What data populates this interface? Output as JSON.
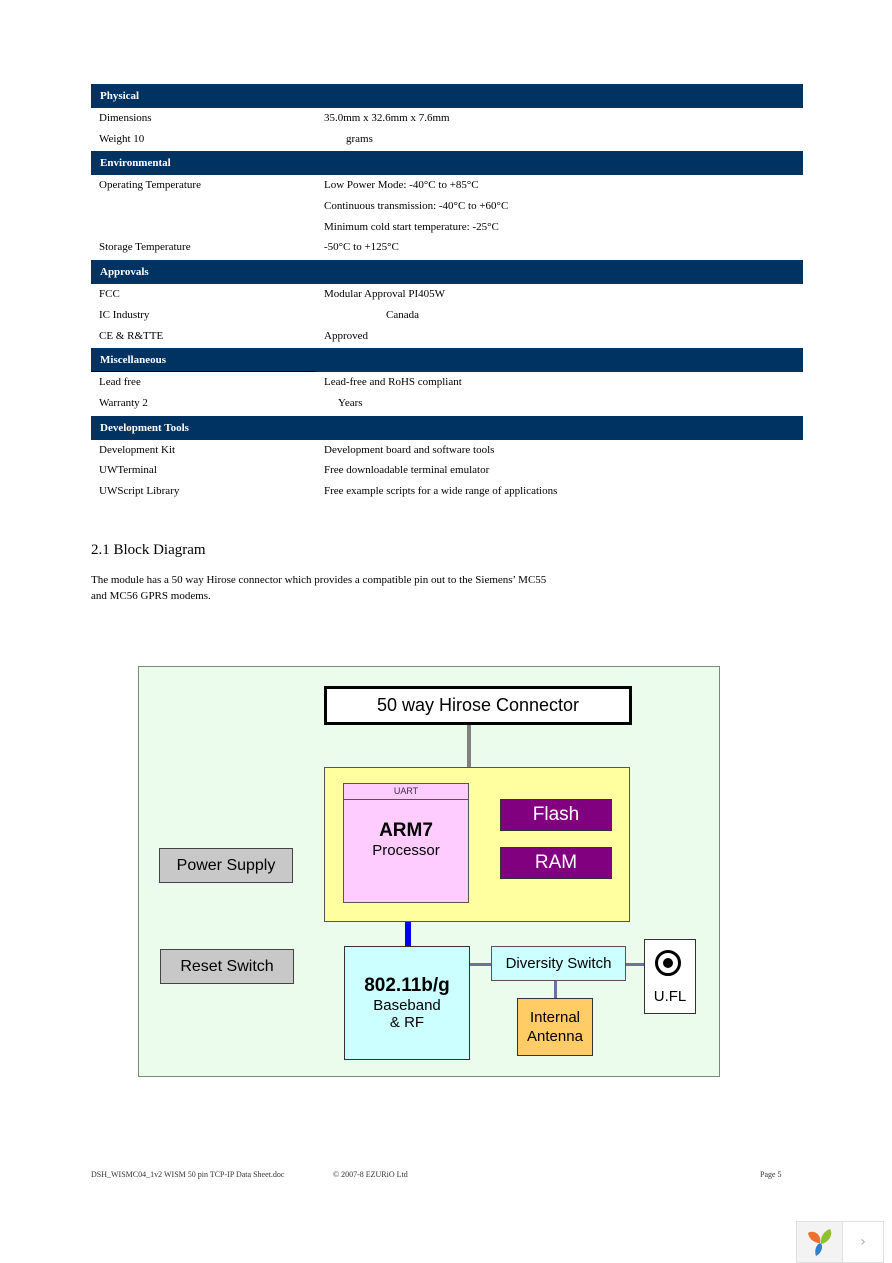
{
  "spec_table": {
    "sections": [
      {
        "title": "Physical",
        "rows": [
          {
            "key": "Dimensions",
            "value": "35.0mm x 32.6mm x 7.6mm"
          },
          {
            "key": "Weight 10",
            "value": "grams"
          }
        ]
      },
      {
        "title": "Environmental",
        "rows": [
          {
            "key": "Operating Temperature",
            "value": "Low Power Mode: -40°C to +85°C"
          },
          {
            "key": "",
            "value": "Continuous transmission: -40°C to +60°C"
          },
          {
            "key": "",
            "value": "Minimum cold start temperature: -25°C"
          },
          {
            "key": "Storage Temperature",
            "value": "-50°C to +125°C"
          }
        ]
      },
      {
        "title": "Approvals",
        "rows": [
          {
            "key": "FCC",
            "value": "Modular Approval PI405W"
          },
          {
            "key": "IC Industry",
            "value": "Canada"
          },
          {
            "key": "CE & R&TTE",
            "value": "Approved"
          }
        ]
      },
      {
        "title": "Miscellaneous",
        "rows": [
          {
            "key": "Lead free",
            "value": "Lead-free and RoHS compliant"
          },
          {
            "key": "Warranty 2",
            "value": "Years"
          }
        ]
      },
      {
        "title": "Development Tools",
        "rows": [
          {
            "key": "Development Kit",
            "value": "Development board and software tools"
          },
          {
            "key": "UWTerminal",
            "value": "Free downloadable terminal emulator"
          },
          {
            "key": "UWScript Library",
            "value": "Free example scripts for a wide range of applications"
          }
        ]
      }
    ]
  },
  "section_heading": "2.1  Block Diagram",
  "paragraph_line1": "The module has a 50 way Hirose connector which provides a compatible pin out to the Siemens’ MC55",
  "paragraph_line2": "and MC56 GPRS modems.",
  "diagram": {
    "connector": "50 way Hirose Connector",
    "uart": "UART",
    "arm_title": "ARM7",
    "arm_sub": "Processor",
    "flash": "Flash",
    "ram": "RAM",
    "power_supply": "Power Supply",
    "reset_switch": "Reset Switch",
    "baseband_title": "802.11b/g",
    "baseband_sub1": "Baseband",
    "baseband_sub2": "& RF",
    "diversity_switch": "Diversity Switch",
    "antenna_line1": "Internal",
    "antenna_line2": "Antenna",
    "ufl": "U.FL",
    "colors": {
      "background": "#ecfcec",
      "soc_area": "#ffffa0",
      "processor": "#ffccff",
      "memory": "#800080",
      "peripheral": "#c8c8c8",
      "baseband": "#ccffff",
      "antenna": "#ffcc66"
    }
  },
  "footer": {
    "doc_name": "DSH_WISMC04_1v2 WISM 50 pin TCP-IP Data Sheet.doc",
    "copyright": "© 2007-8 EZURiO Ltd",
    "page": "Page 5"
  },
  "nav": {
    "next_label": "›"
  },
  "colors": {
    "header_band": "#003262"
  }
}
